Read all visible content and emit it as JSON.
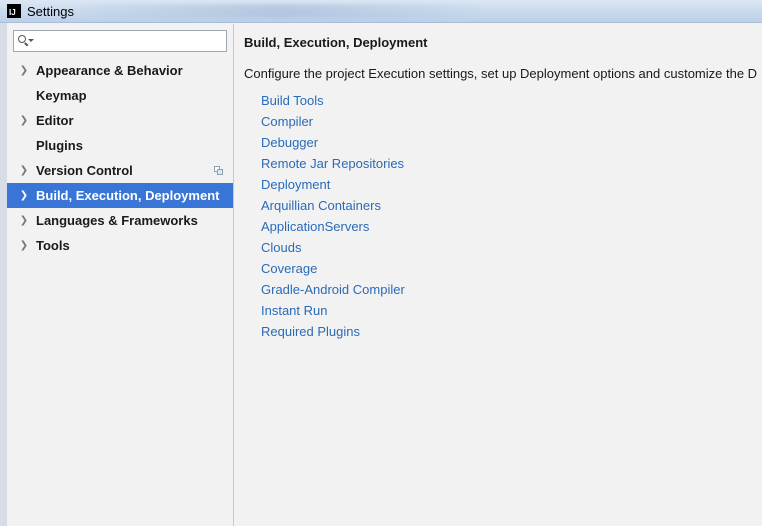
{
  "window": {
    "title": "Settings",
    "app_icon": "intellij-icon",
    "app_icon_text": "IJ"
  },
  "search": {
    "value": "",
    "placeholder": ""
  },
  "sidebar": {
    "items": [
      {
        "label": "Appearance & Behavior",
        "expandable": true
      },
      {
        "label": "Keymap",
        "expandable": false
      },
      {
        "label": "Editor",
        "expandable": true
      },
      {
        "label": "Plugins",
        "expandable": false
      },
      {
        "label": "Version Control",
        "expandable": true,
        "has_project_icon": true
      },
      {
        "label": "Build, Execution, Deployment",
        "expandable": true,
        "selected": true
      },
      {
        "label": "Languages & Frameworks",
        "expandable": true
      },
      {
        "label": "Tools",
        "expandable": true
      }
    ]
  },
  "main": {
    "title": "Build, Execution, Deployment",
    "description": "Configure the project Execution settings, set up Deployment options and customize the D",
    "links": [
      "Build Tools",
      "Compiler",
      "Debugger",
      "Remote Jar Repositories",
      "Deployment",
      "Arquillian Containers",
      "ApplicationServers",
      "Clouds",
      "Coverage",
      "Gradle-Android Compiler",
      "Instant Run",
      "Required Plugins"
    ]
  },
  "colors": {
    "selection": "#3875d7",
    "link": "#2a6bb8",
    "background": "#f2f2f2"
  }
}
